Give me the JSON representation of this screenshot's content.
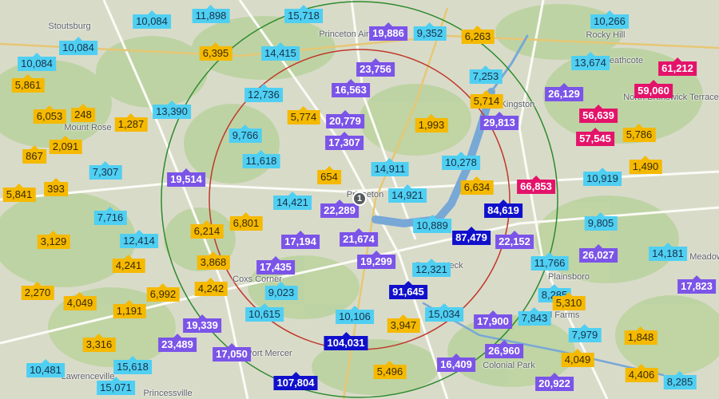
{
  "map": {
    "colors": {
      "land": "#d9dbc9",
      "forest": "#bcd3a0",
      "water": "#78a8d6",
      "inner_ring": "#c0392b",
      "outer_ring": "#2e8b2e",
      "tiers": {
        "cyan": "#4fcff2",
        "yellow": "#f5b900",
        "purple": "#7b54e8",
        "navy": "#1010cc",
        "pink": "#e4136a"
      }
    },
    "center_pin_label": "1",
    "place_names": [
      "Stoutsburg",
      "Rocky Hill",
      "Heathcote",
      "Princeton Airport",
      "Mount Rose",
      "Kingston",
      "Princeton",
      "Penns Neck",
      "Plainsboro",
      "Princeton Meadows",
      "Coxs Corner",
      "Port Mercer",
      "Lawrenceville",
      "Princessville",
      "Colonial Park",
      "Mill Farms",
      "North Brunswick Terrace"
    ],
    "markers": [
      {
        "value": "10,084",
        "tier": "cyan"
      },
      {
        "value": "11,898",
        "tier": "cyan"
      },
      {
        "value": "15,718",
        "tier": "cyan"
      },
      {
        "value": "19,886",
        "tier": "purple"
      },
      {
        "value": "9,352",
        "tier": "cyan"
      },
      {
        "value": "6,263",
        "tier": "yellow"
      },
      {
        "value": "10,266",
        "tier": "cyan"
      },
      {
        "value": "10,084",
        "tier": "cyan"
      },
      {
        "value": "10,084",
        "tier": "cyan"
      },
      {
        "value": "6,395",
        "tier": "yellow"
      },
      {
        "value": "14,415",
        "tier": "cyan"
      },
      {
        "value": "23,756",
        "tier": "purple"
      },
      {
        "value": "13,674",
        "tier": "cyan"
      },
      {
        "value": "61,212",
        "tier": "pink"
      },
      {
        "value": "5,861",
        "tier": "yellow"
      },
      {
        "value": "16,563",
        "tier": "purple"
      },
      {
        "value": "7,253",
        "tier": "cyan"
      },
      {
        "value": "59,060",
        "tier": "pink"
      },
      {
        "value": "12,736",
        "tier": "cyan"
      },
      {
        "value": "26,129",
        "tier": "purple"
      },
      {
        "value": "5,714",
        "tier": "yellow"
      },
      {
        "value": "13,390",
        "tier": "cyan"
      },
      {
        "value": "6,053",
        "tier": "yellow"
      },
      {
        "value": "248",
        "tier": "yellow"
      },
      {
        "value": "5,774",
        "tier": "yellow"
      },
      {
        "value": "20,779",
        "tier": "purple"
      },
      {
        "value": "56,639",
        "tier": "pink"
      },
      {
        "value": "1,287",
        "tier": "yellow"
      },
      {
        "value": "1,993",
        "tier": "yellow"
      },
      {
        "value": "29,813",
        "tier": "purple"
      },
      {
        "value": "9,766",
        "tier": "cyan"
      },
      {
        "value": "17,307",
        "tier": "purple"
      },
      {
        "value": "57,545",
        "tier": "pink"
      },
      {
        "value": "5,786",
        "tier": "yellow"
      },
      {
        "value": "2,091",
        "tier": "yellow"
      },
      {
        "value": "867",
        "tier": "yellow"
      },
      {
        "value": "11,618",
        "tier": "cyan"
      },
      {
        "value": "10,278",
        "tier": "cyan"
      },
      {
        "value": "1,490",
        "tier": "yellow"
      },
      {
        "value": "7,307",
        "tier": "cyan"
      },
      {
        "value": "14,911",
        "tier": "cyan"
      },
      {
        "value": "654",
        "tier": "yellow"
      },
      {
        "value": "19,514",
        "tier": "purple"
      },
      {
        "value": "10,919",
        "tier": "cyan"
      },
      {
        "value": "6,634",
        "tier": "yellow"
      },
      {
        "value": "66,853",
        "tier": "pink"
      },
      {
        "value": "5,841",
        "tier": "yellow"
      },
      {
        "value": "393",
        "tier": "yellow"
      },
      {
        "value": "14,421",
        "tier": "cyan"
      },
      {
        "value": "14,921",
        "tier": "cyan"
      },
      {
        "value": "22,289",
        "tier": "purple"
      },
      {
        "value": "84,619",
        "tier": "navy"
      },
      {
        "value": "7,716",
        "tier": "cyan"
      },
      {
        "value": "6,801",
        "tier": "yellow"
      },
      {
        "value": "9,805",
        "tier": "cyan"
      },
      {
        "value": "10,889",
        "tier": "cyan"
      },
      {
        "value": "6,214",
        "tier": "yellow"
      },
      {
        "value": "3,129",
        "tier": "yellow"
      },
      {
        "value": "12,414",
        "tier": "cyan"
      },
      {
        "value": "17,194",
        "tier": "purple"
      },
      {
        "value": "21,674",
        "tier": "purple"
      },
      {
        "value": "87,479",
        "tier": "navy"
      },
      {
        "value": "22,152",
        "tier": "purple"
      },
      {
        "value": "26,027",
        "tier": "purple"
      },
      {
        "value": "14,181",
        "tier": "cyan"
      },
      {
        "value": "4,241",
        "tier": "yellow"
      },
      {
        "value": "3,868",
        "tier": "yellow"
      },
      {
        "value": "17,435",
        "tier": "purple"
      },
      {
        "value": "19,299",
        "tier": "purple"
      },
      {
        "value": "12,321",
        "tier": "cyan"
      },
      {
        "value": "11,766",
        "tier": "cyan"
      },
      {
        "value": "17,823",
        "tier": "purple"
      },
      {
        "value": "2,270",
        "tier": "yellow"
      },
      {
        "value": "6,992",
        "tier": "yellow"
      },
      {
        "value": "4,242",
        "tier": "yellow"
      },
      {
        "value": "9,023",
        "tier": "cyan"
      },
      {
        "value": "91,645",
        "tier": "navy"
      },
      {
        "value": "8,285",
        "tier": "cyan"
      },
      {
        "value": "4,049",
        "tier": "yellow"
      },
      {
        "value": "5,310",
        "tier": "yellow"
      },
      {
        "value": "1,191",
        "tier": "yellow"
      },
      {
        "value": "10,615",
        "tier": "cyan"
      },
      {
        "value": "19,339",
        "tier": "purple"
      },
      {
        "value": "10,106",
        "tier": "cyan"
      },
      {
        "value": "3,947",
        "tier": "yellow"
      },
      {
        "value": "15,034",
        "tier": "cyan"
      },
      {
        "value": "17,900",
        "tier": "purple"
      },
      {
        "value": "7,843",
        "tier": "cyan"
      },
      {
        "value": "7,979",
        "tier": "cyan"
      },
      {
        "value": "1,848",
        "tier": "yellow"
      },
      {
        "value": "3,316",
        "tier": "yellow"
      },
      {
        "value": "23,489",
        "tier": "purple"
      },
      {
        "value": "104,031",
        "tier": "navy"
      },
      {
        "value": "26,960",
        "tier": "purple"
      },
      {
        "value": "4,049",
        "tier": "yellow"
      },
      {
        "value": "10,481",
        "tier": "cyan"
      },
      {
        "value": "15,618",
        "tier": "cyan"
      },
      {
        "value": "17,050",
        "tier": "purple"
      },
      {
        "value": "16,409",
        "tier": "purple"
      },
      {
        "value": "4,406",
        "tier": "yellow"
      },
      {
        "value": "5,496",
        "tier": "yellow"
      },
      {
        "value": "8,285",
        "tier": "cyan"
      },
      {
        "value": "15,071",
        "tier": "cyan"
      },
      {
        "value": "107,804",
        "tier": "navy"
      },
      {
        "value": "20,922",
        "tier": "purple"
      }
    ]
  }
}
